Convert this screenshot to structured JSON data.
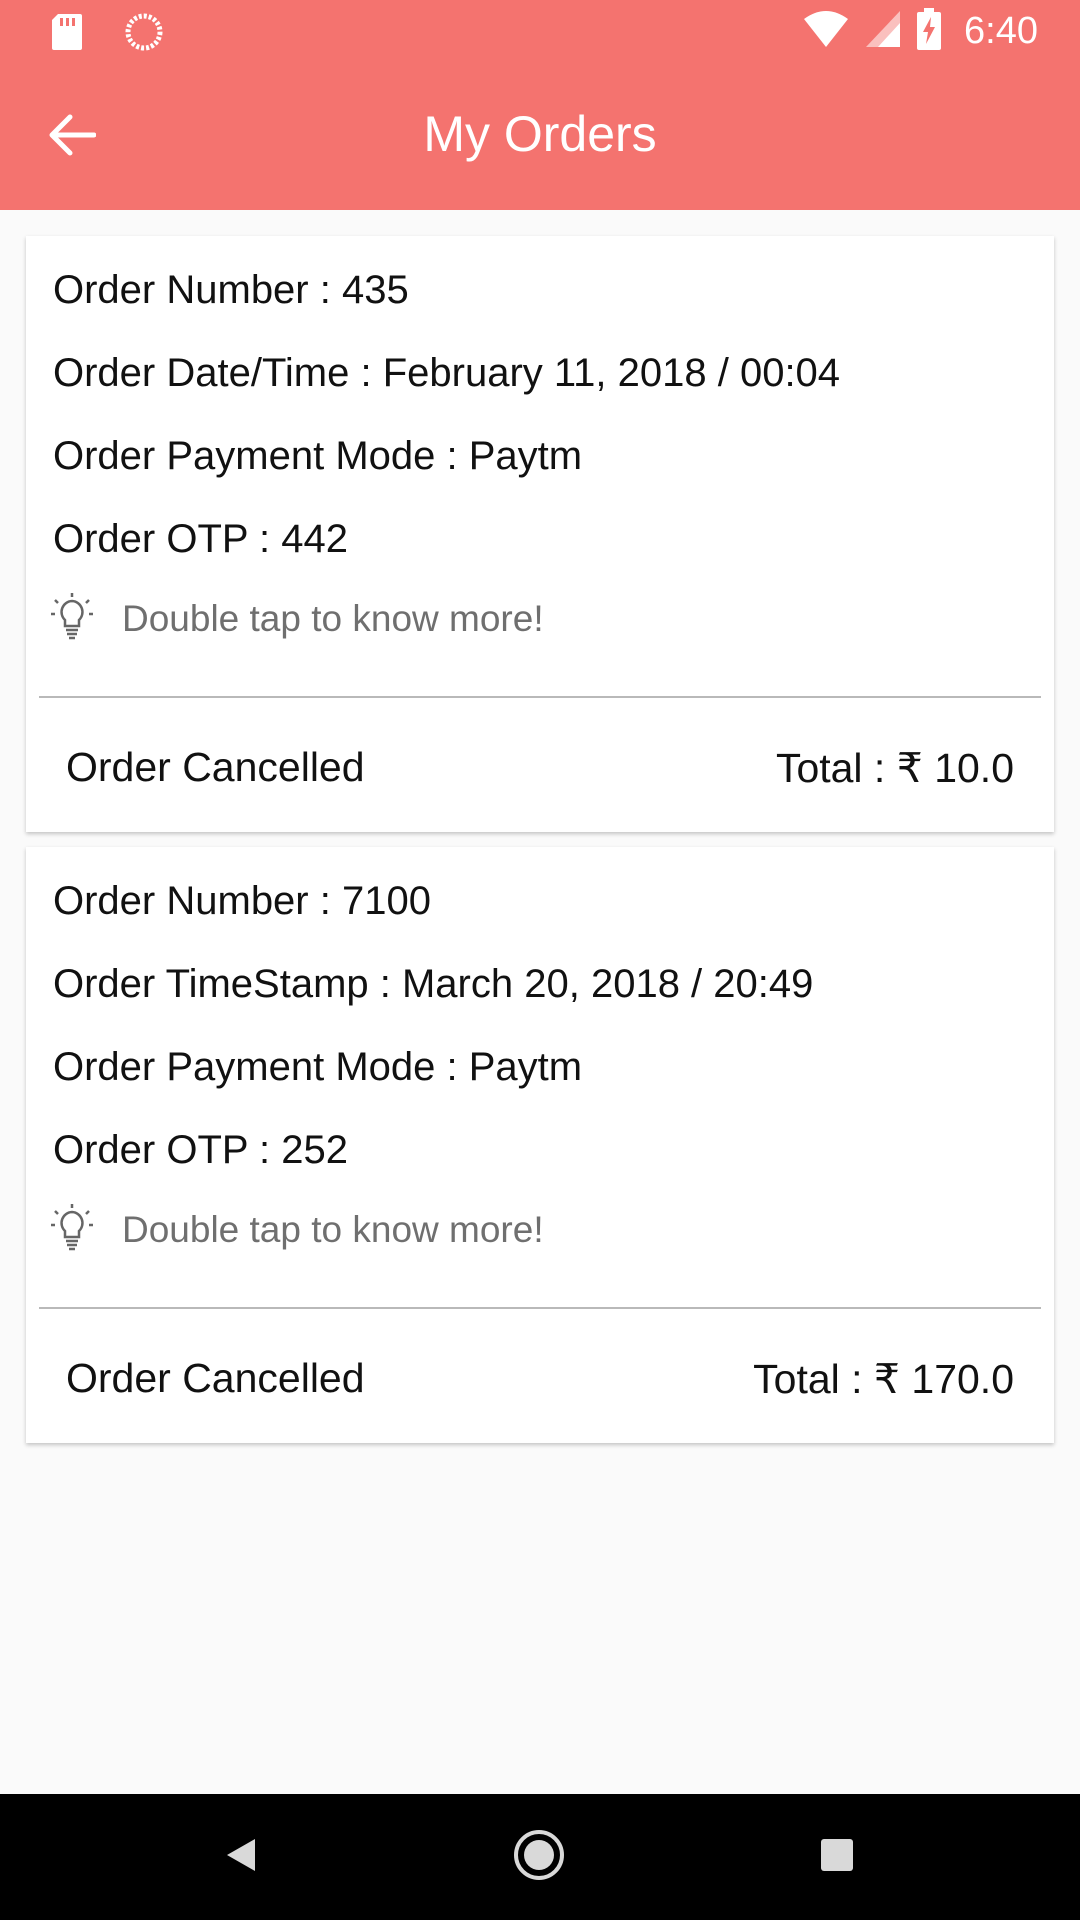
{
  "status_bar": {
    "time": "6:40",
    "icons": [
      "sd-card-icon",
      "sync-icon",
      "wifi-icon",
      "signal-icon",
      "battery-charging-icon"
    ]
  },
  "app_bar": {
    "title": "My Orders",
    "back_icon": "arrow-back-icon"
  },
  "orders": [
    {
      "number": "Order Number : 435",
      "datetime": "Order Date/Time : February 11, 2018 / 00:04",
      "payment": "Order Payment Mode : Paytm",
      "otp": "Order OTP : 442",
      "hint": "Double tap to know more!",
      "status": "Order Cancelled",
      "total": "Total : ₹ 10.0"
    },
    {
      "number": "Order Number : 7100",
      "datetime": "Order TimeStamp : March 20, 2018 / 20:49",
      "payment": "Order Payment Mode : Paytm",
      "otp": "Order OTP : 252",
      "hint": "Double tap to know more!",
      "status": "Order Cancelled",
      "total": "Total : ₹ 170.0"
    }
  ],
  "nav_bar": {
    "icons": [
      "nav-back-icon",
      "nav-home-icon",
      "nav-recents-icon"
    ]
  },
  "colors": {
    "primary": "#f4736f",
    "background": "#fafafa",
    "hint_text": "#6f6f6f"
  }
}
